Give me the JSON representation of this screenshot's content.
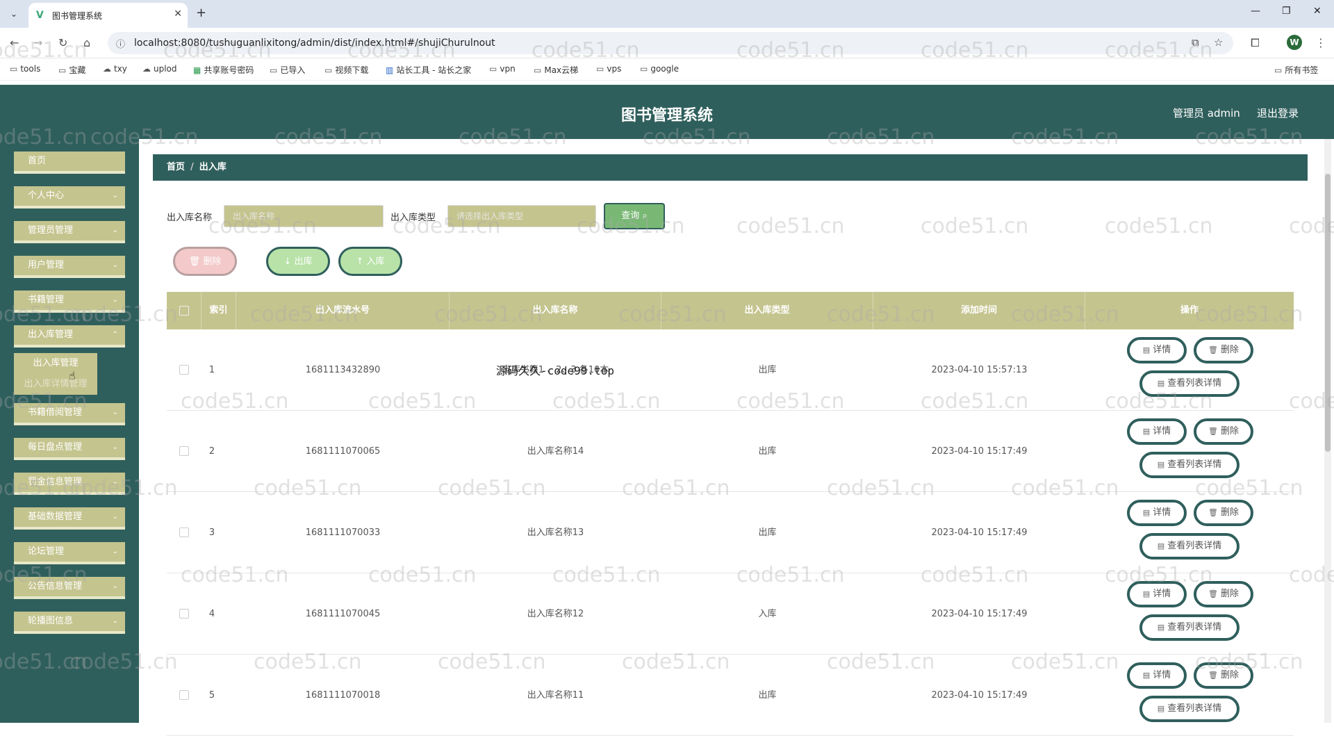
{
  "browser": {
    "tab_title": "图书管理系统",
    "url": "localhost:8080/tushuguanlixitong/admin/dist/index.html#/shujiChurulnout",
    "profile_initial": "W",
    "bookmarks": [
      "tools",
      "宝藏",
      "txy",
      "uplod",
      "共享账号密码",
      "已导入",
      "视频下载",
      "站长工具 - 站长之家",
      "vpn",
      "Max云梯",
      "vps",
      "google",
      "所有书签"
    ]
  },
  "header": {
    "title": "图书管理系统",
    "user": "管理员 admin",
    "logout": "退出登录"
  },
  "sidebar": {
    "items": [
      {
        "label": "首页"
      },
      {
        "label": "个人中心"
      },
      {
        "label": "管理员管理"
      },
      {
        "label": "用户管理"
      },
      {
        "label": "书籍管理"
      },
      {
        "label": "出入库管理"
      },
      {
        "label": "书籍借阅管理"
      },
      {
        "label": "每日盘点管理"
      },
      {
        "label": "罚金信息管理"
      },
      {
        "label": "基础数据管理"
      },
      {
        "label": "论坛管理"
      },
      {
        "label": "公告信息管理"
      },
      {
        "label": "轮播图信息"
      }
    ],
    "submenu": [
      "出入库管理",
      "出入库详情管理"
    ]
  },
  "breadcrumb": {
    "home": "首页",
    "current": "出入库"
  },
  "search": {
    "name_label": "出入库名称",
    "name_placeholder": "出入库名称",
    "type_label": "出入库类型",
    "type_placeholder": "请选择出入库类型",
    "query_button": "查询"
  },
  "actions": {
    "delete": "删除",
    "out": "出库",
    "in": "入库"
  },
  "table": {
    "columns": [
      "索引",
      "出入库流水号",
      "出入库名称",
      "出入库类型",
      "添加时间",
      "操作"
    ],
    "rows": [
      {
        "index": "1",
        "serial": "1681113432890",
        "name": "出库书籍1 、2、3 各10本",
        "type": "出库",
        "time": "2023-04-10 15:57:13"
      },
      {
        "index": "2",
        "serial": "1681111070065",
        "name": "出入库名称14",
        "type": "出库",
        "time": "2023-04-10 15:17:49"
      },
      {
        "index": "3",
        "serial": "1681111070033",
        "name": "出入库名称13",
        "type": "出库",
        "time": "2023-04-10 15:17:49"
      },
      {
        "index": "4",
        "serial": "1681111070045",
        "name": "出入库名称12",
        "type": "入库",
        "time": "2023-04-10 15:17:49"
      },
      {
        "index": "5",
        "serial": "1681111070018",
        "name": "出入库名称11",
        "type": "出库",
        "time": "2023-04-10 15:17:49"
      }
    ],
    "op_detail": "详情",
    "op_delete": "删除",
    "op_list": "查看列表详情"
  },
  "overlay_text": "源码久久-code99.top",
  "watermark": "code51.cn"
}
